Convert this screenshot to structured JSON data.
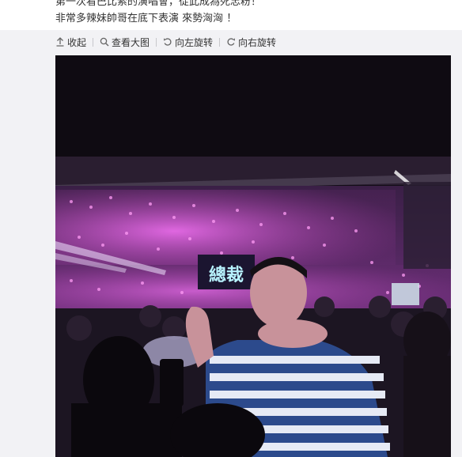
{
  "post": {
    "line1": "第一次看巴比索的演唱會，從此成為死忠粉！",
    "line2": "非常多辣妹帥哥在底下表演 來勢洶洶 ！"
  },
  "toolbar": {
    "items": [
      {
        "label": "收起",
        "icon": "collapse-arrow-up-icon"
      },
      {
        "label": "查看大图",
        "icon": "search-icon"
      },
      {
        "label": "向左旋转",
        "icon": "rotate-left-icon"
      },
      {
        "label": "向右旋转",
        "icon": "rotate-right-icon"
      }
    ]
  },
  "photo": {
    "sign_text": "總裁",
    "subject": "concert-crowd-photo"
  },
  "colors": {
    "panel_bg": "#f2f2f5",
    "text": "#333333",
    "lightsticks": "#d65adf"
  }
}
